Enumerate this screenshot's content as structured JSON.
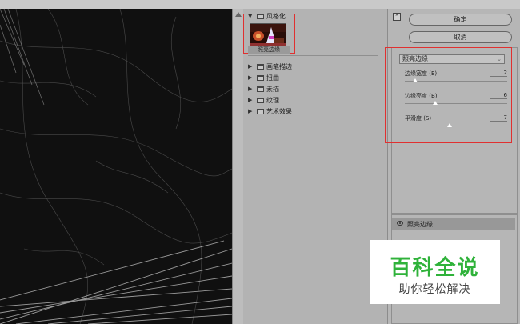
{
  "gallery": {
    "category_open": "风格化",
    "selected_filter_thumb_label": "照亮边缘",
    "categories": [
      "画笔描边",
      "扭曲",
      "素描",
      "纹理",
      "艺术效果"
    ]
  },
  "buttons": {
    "ok": "确定",
    "cancel": "取消"
  },
  "settings": {
    "filter": "照亮边缘",
    "params": [
      {
        "label": "边缘宽度 (E)",
        "value": "2",
        "level": 0.1
      },
      {
        "label": "边缘亮度 (B)",
        "value": "6",
        "level": 0.3
      },
      {
        "label": "平滑度 (S)",
        "value": "7",
        "level": 0.45
      }
    ]
  },
  "layers": {
    "item": "照亮边缘"
  },
  "watermark": {
    "title": "百科全说",
    "subtitle": "助你轻松解决"
  },
  "colors": {
    "highlight_box": "#e03030",
    "watermark_green": "#2fb23a"
  }
}
